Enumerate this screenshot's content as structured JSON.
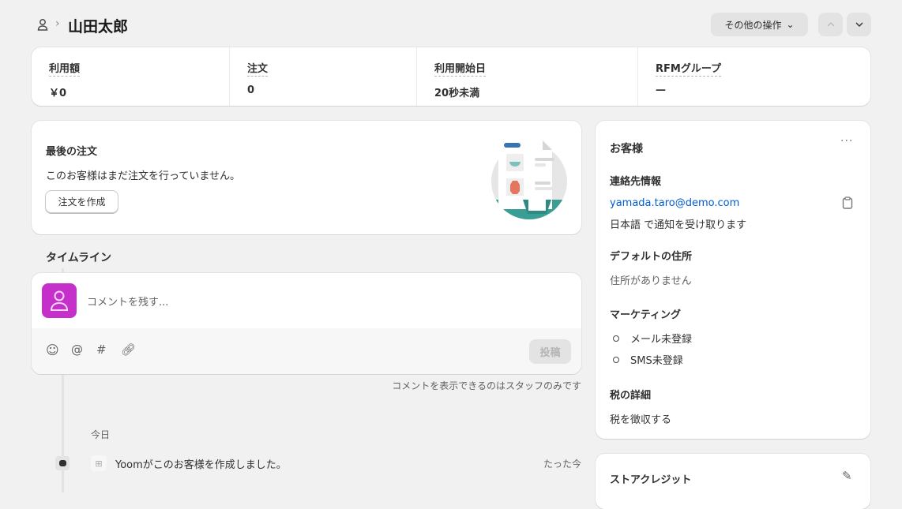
{
  "header": {
    "title": "山田太郎",
    "more_actions": "その他の操作"
  },
  "stats": [
    {
      "label": "利用額",
      "value": "￥0"
    },
    {
      "label": "注文",
      "value": "0"
    },
    {
      "label": "利用開始日",
      "value": "20秒未満"
    },
    {
      "label": "RFMグループ",
      "value": "—"
    }
  ],
  "last_order": {
    "title": "最後の注文",
    "message": "このお客様はまだ注文を行っていません。",
    "create_button": "注文を作成"
  },
  "timeline": {
    "title": "タイムライン",
    "comment_placeholder": "コメントを残す...",
    "post_button": "投稿",
    "staff_note": "コメントを表示できるのはスタッフのみです",
    "date_label": "今日",
    "events": [
      {
        "text": "Yoomがこのお客様を作成しました。",
        "time": "たった今"
      }
    ]
  },
  "customer": {
    "title": "お客様",
    "contact_heading": "連絡先情報",
    "email": "yamada.taro@demo.com",
    "notify": "日本語 で通知を受け取ります",
    "address_heading": "デフォルトの住所",
    "address": "住所がありません",
    "marketing_heading": "マーケティング",
    "marketing": [
      "メール未登録",
      "SMS未登録"
    ],
    "tax_heading": "税の詳細",
    "tax": "税を徴収する"
  },
  "store_credit": {
    "title": "ストアクレジット"
  },
  "colors": {
    "accent": "#005bd3",
    "avatar": "#c430c9",
    "teal": "#3b9e95"
  }
}
